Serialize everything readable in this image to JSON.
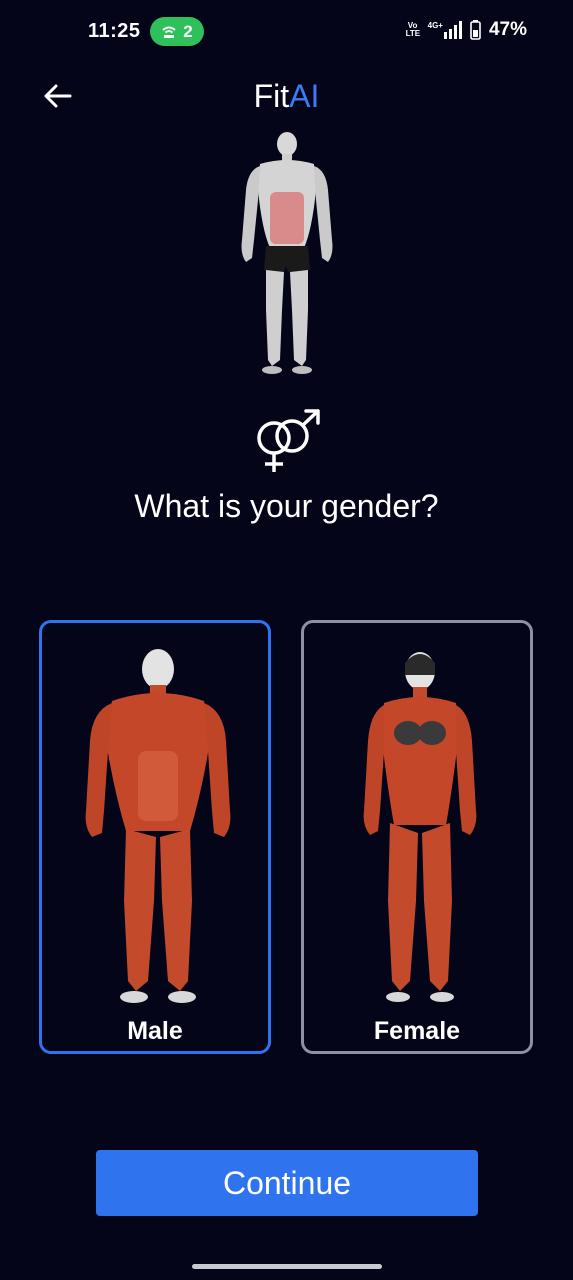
{
  "status_bar": {
    "time": "11:25",
    "hotspot_count": "2",
    "volte_top": "Vo",
    "volte_bottom": "LTE",
    "network": "4G+",
    "battery": "47%"
  },
  "header": {
    "title_part1": "Fit",
    "title_part2": "AI",
    "back_icon": "arrow-left-icon"
  },
  "question": "What is your gender?",
  "options": [
    {
      "label": "Male",
      "selected": true
    },
    {
      "label": "Female",
      "selected": false
    }
  ],
  "continue_label": "Continue",
  "colors": {
    "background": "#05051a",
    "accent": "#2f74ee",
    "unselected_border": "#8e91a4",
    "hotspot_green": "#2ec05a"
  }
}
